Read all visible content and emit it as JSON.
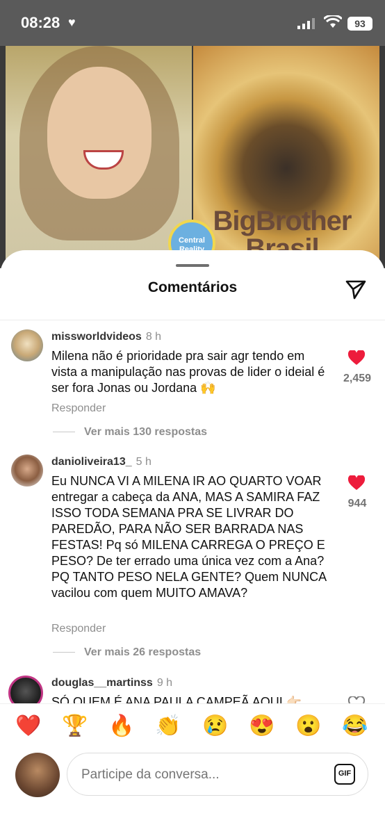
{
  "status_bar": {
    "time": "08:28",
    "battery": "93"
  },
  "video": {
    "badge_text": "Central Reality",
    "right_title": "BigBrother Brasil"
  },
  "sheet": {
    "title": "Comentários"
  },
  "comments": [
    {
      "username": "missworldvideos",
      "time": "8 h",
      "text": "Milena não é prioridade pra sair agr tendo em vista a manipulação nas provas de lider o ideial é ser fora Jonas ou Jordana 🙌",
      "reply_label": "Responder",
      "more_replies": "Ver mais 130 respostas",
      "likes": "2,459",
      "liked": true
    },
    {
      "username": "danioliveira13_",
      "time": "5 h",
      "text": "Eu NUNCA VI A MILENA IR AO QUARTO VOAR entregar a cabeça da ANA, MAS A SAMIRA FAZ ISSO TODA SEMANA PRA SE LIVRAR DO PAREDÃO, PARA NÃO SER BARRADA NAS FESTAS! Pq só MILENA CARREGA O PREÇO E PESO? De ter errado uma única vez com a Ana? PQ TANTO PESO NELA GENTE? Quem NUNCA vacilou com quem MUITO AMAVA?",
      "reply_label": "Responder",
      "more_replies": "Ver mais 26 respostas",
      "likes": "944",
      "liked": true
    },
    {
      "username": "douglas__martinss",
      "time": "9 h",
      "text": "SÓ QUEM É ANA PAULA CAMPEÃ AQUI 👉🏻",
      "liked": false
    }
  ],
  "reactions": [
    "❤️",
    "🏆",
    "🔥",
    "👏",
    "😢",
    "😍",
    "😮",
    "😂"
  ],
  "composer": {
    "placeholder": "Participe da conversa...",
    "gif_label": "GIF"
  },
  "colors": {
    "like_red": "#ed1c3c",
    "status_bar": "#5a5a5a"
  }
}
